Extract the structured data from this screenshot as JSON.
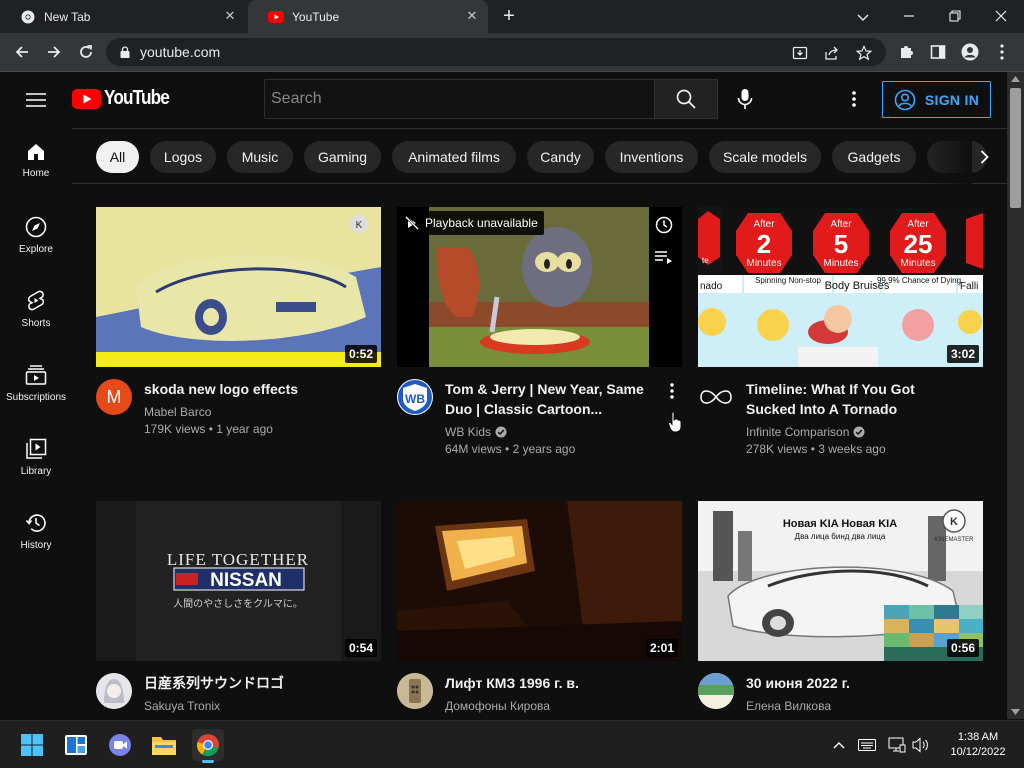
{
  "browser": {
    "tabs": [
      {
        "title": "New Tab"
      },
      {
        "title": "YouTube"
      }
    ],
    "url": "youtube.com"
  },
  "youtube": {
    "logo_text": "YouTube",
    "search_placeholder": "Search",
    "signin_label": "SIGN IN",
    "sidebar": [
      {
        "label": "Home",
        "icon": "home-icon"
      },
      {
        "label": "Explore",
        "icon": "compass-icon"
      },
      {
        "label": "Shorts",
        "icon": "shorts-icon"
      },
      {
        "label": "Subscriptions",
        "icon": "subscriptions-icon"
      },
      {
        "label": "Library",
        "icon": "library-icon"
      },
      {
        "label": "History",
        "icon": "history-icon"
      }
    ],
    "chips": [
      "All",
      "Logos",
      "Music",
      "Gaming",
      "Animated films",
      "Candy",
      "Inventions",
      "Scale models",
      "Gadgets"
    ],
    "videos": [
      {
        "title": "skoda new logo effects",
        "channel": "Mabel Barco",
        "verified": false,
        "views": "179K views",
        "age": "1 year ago",
        "duration": "0:52",
        "avatar_letter": "M"
      },
      {
        "title": "Tom & Jerry | New Year, Same Duo | Classic Cartoon...",
        "channel": "WB Kids",
        "verified": true,
        "views": "64M views",
        "age": "2 years ago",
        "overlay": "Playback unavailable"
      },
      {
        "title": "Timeline: What If You Got Sucked Into A Tornado",
        "channel": "Infinite Comparison",
        "verified": true,
        "views": "278K views",
        "age": "3 weeks ago",
        "duration": "3:02"
      },
      {
        "title": "日産系列サウンドロゴ",
        "channel": "Sakuya Tronix",
        "verified": false,
        "duration": "0:54"
      },
      {
        "title": "Лифт КМЗ 1996 г. в.",
        "channel": "Домофоны Кирова",
        "verified": false,
        "duration": "2:01"
      },
      {
        "title": "30 июня 2022 г.",
        "channel": "Елена Вилкова",
        "verified": false,
        "duration": "0:56"
      }
    ],
    "thumb_text": {
      "tornado_labels": [
        "After",
        "2",
        "Minutes",
        "After",
        "5",
        "Minutes",
        "After",
        "25",
        "Minutes"
      ],
      "tornado_captions": [
        "nado",
        "Spinning Non-stop",
        "Body Bruises",
        "99.9% Chance of Dying",
        "Falli"
      ],
      "nissan_line1": "LIFE TOGETHER",
      "nissan_brand": "NISSAN",
      "nissan_line3": "人間のやさしさをクルマに。",
      "kia_line1": "Новая KIA Новая KIA",
      "kia_line2": "Два лица бинд два лица",
      "kinemaster": "KINEMASTER"
    }
  },
  "taskbar": {
    "time": "1:38 AM",
    "date": "10/12/2022"
  }
}
